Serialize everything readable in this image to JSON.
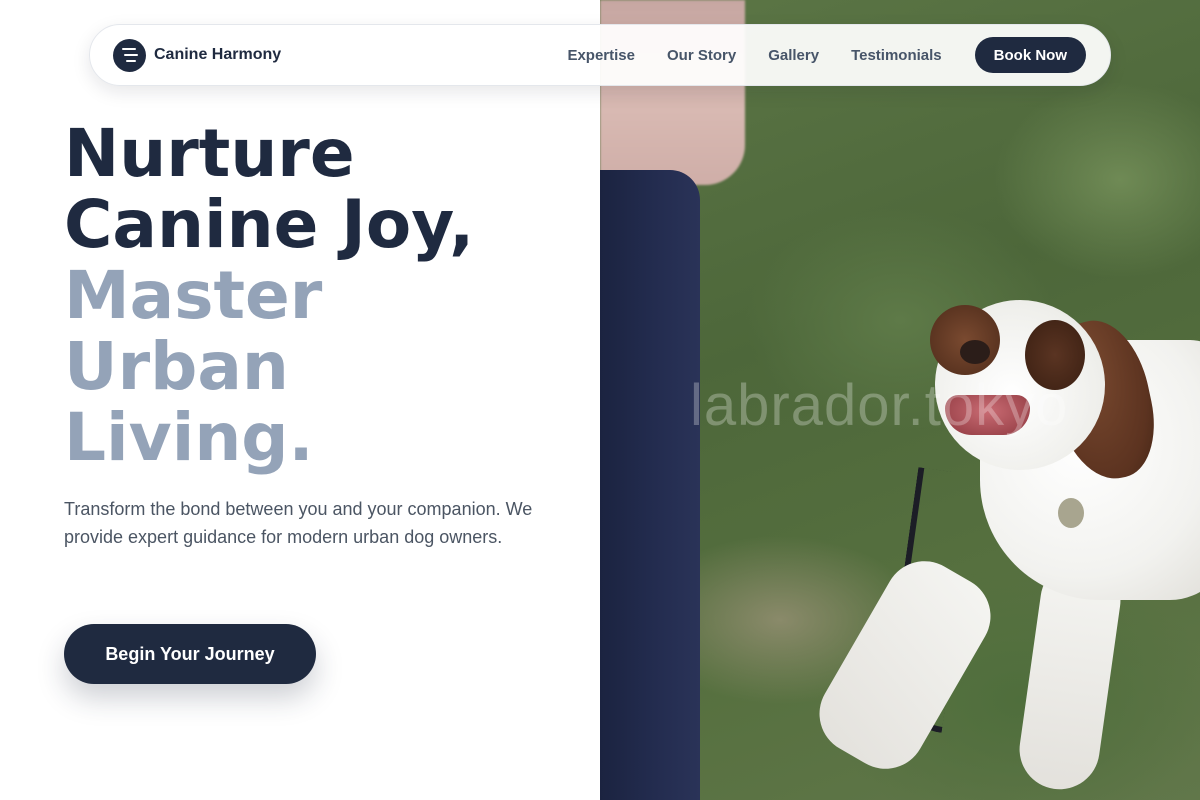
{
  "nav": {
    "brand_name": "Canine Harmony",
    "brand_icon": "menu-lines-icon",
    "links": [
      "Expertise",
      "Our Story",
      "Gallery",
      "Testimonials"
    ],
    "cta_label": "Book Now"
  },
  "hero": {
    "headline_dark": [
      "Nurture",
      "Canine Joy,"
    ],
    "headline_muted": [
      "Master",
      "Urban",
      "Living."
    ],
    "lead": "Transform the bond between you and your companion. We provide expert guidance for modern urban dog owners.",
    "cta_label": "Begin Your Journey"
  },
  "photo": {
    "watermark": "labrador.tokyo"
  },
  "colors": {
    "primary": "#1f2a40",
    "muted_heading": "#94a3b8",
    "body_text": "#4b5563",
    "nav_text": "#475569"
  }
}
